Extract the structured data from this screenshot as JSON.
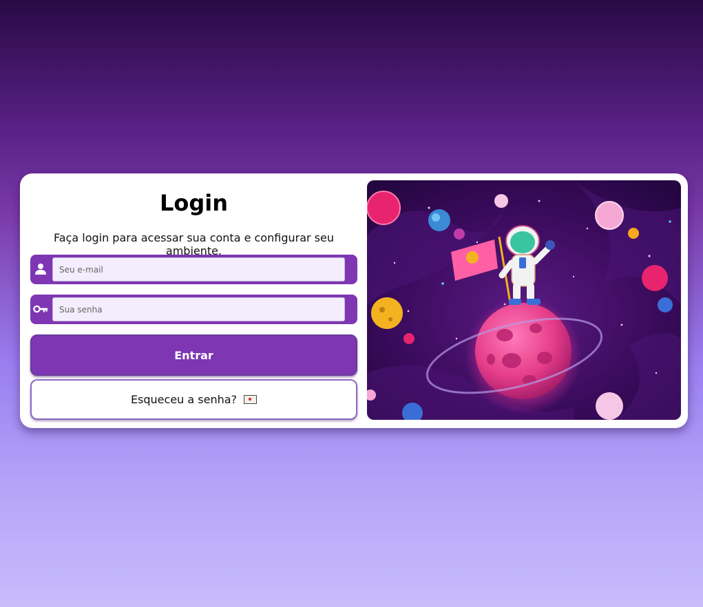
{
  "login": {
    "title": "Login",
    "subtitle": "Faça login para acessar sua conta e configurar seu ambiente.",
    "email": {
      "placeholder": "Seu e-mail",
      "value": "",
      "icon": "user-icon"
    },
    "password": {
      "placeholder": "Sua senha",
      "value": "",
      "icon": "key-icon"
    },
    "submit_label": "Entrar",
    "forgot_label": "Esqueceu a senha?",
    "forgot_icon": "envelope-icon"
  },
  "illustration": {
    "icon": "astronaut-planet-illustration"
  },
  "colors": {
    "accent": "#7e36b2",
    "input_bg": "#f3edfd",
    "card": "#ffffff"
  }
}
